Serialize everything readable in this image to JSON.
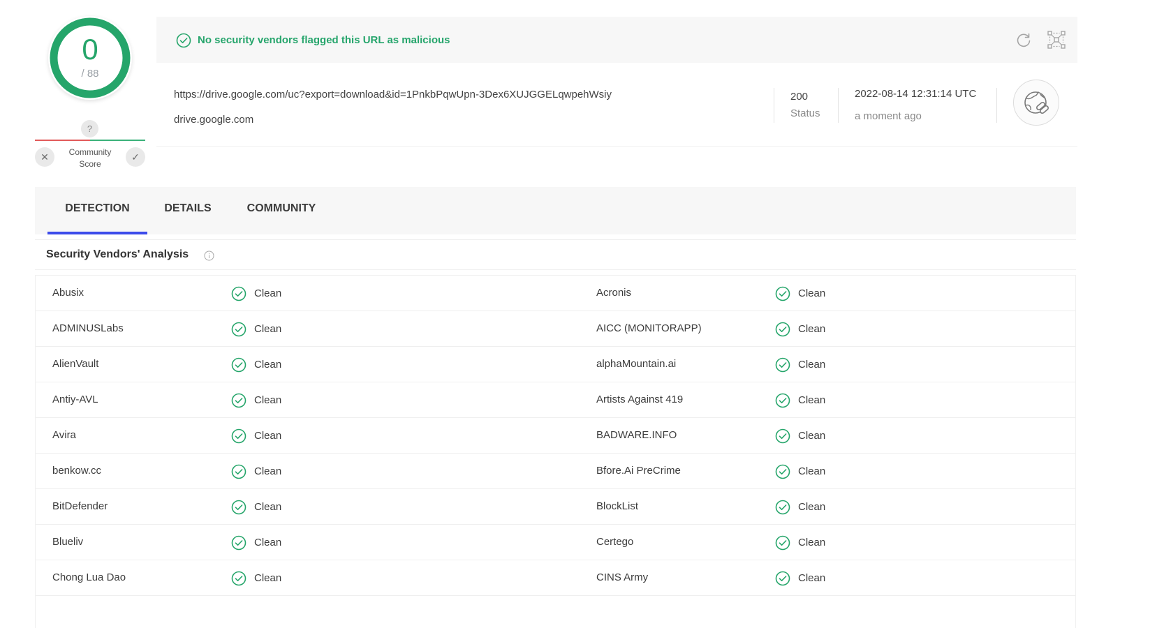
{
  "score": {
    "detections": "0",
    "total": "/ 88"
  },
  "community": {
    "question": "?",
    "label_line1": "Community",
    "label_line2": "Score",
    "down_glyph": "✕",
    "up_glyph": "✓"
  },
  "banner": {
    "message": "No security vendors flagged this URL as malicious"
  },
  "url_info": {
    "url": "https://drive.google.com/uc?export=download&id=1PnkbPqwUpn-3Dex6XUJGGELqwpehWsiy",
    "domain": "drive.google.com",
    "status_code": "200",
    "status_label": "Status",
    "scan_date": "2022-08-14 12:31:14 UTC",
    "scan_ago": "a moment ago"
  },
  "tabs": [
    {
      "label": "DETECTION",
      "active": true
    },
    {
      "label": "DETAILS",
      "active": false
    },
    {
      "label": "COMMUNITY",
      "active": false
    }
  ],
  "analysis": {
    "title": "Security Vendors' Analysis"
  },
  "vendors": [
    {
      "left_name": "Abusix",
      "left_result": "Clean",
      "right_name": "Acronis",
      "right_result": "Clean"
    },
    {
      "left_name": "ADMINUSLabs",
      "left_result": "Clean",
      "right_name": "AICC (MONITORAPP)",
      "right_result": "Clean"
    },
    {
      "left_name": "AlienVault",
      "left_result": "Clean",
      "right_name": "alphaMountain.ai",
      "right_result": "Clean"
    },
    {
      "left_name": "Antiy-AVL",
      "left_result": "Clean",
      "right_name": "Artists Against 419",
      "right_result": "Clean"
    },
    {
      "left_name": "Avira",
      "left_result": "Clean",
      "right_name": "BADWARE.INFO",
      "right_result": "Clean"
    },
    {
      "left_name": "benkow.cc",
      "left_result": "Clean",
      "right_name": "Bfore.Ai PreCrime",
      "right_result": "Clean"
    },
    {
      "left_name": "BitDefender",
      "left_result": "Clean",
      "right_name": "BlockList",
      "right_result": "Clean"
    },
    {
      "left_name": "Blueliv",
      "left_result": "Clean",
      "right_name": "Certego",
      "right_result": "Clean"
    },
    {
      "left_name": "Chong Lua Dao",
      "left_result": "Clean",
      "right_name": "CINS Army",
      "right_result": "Clean"
    }
  ],
  "colors": {
    "clean": "#25a56a",
    "tab_accent": "#3d4bea",
    "ring": "#25a56a"
  },
  "icons": {
    "banner": "check-circle-icon",
    "refresh": "refresh-icon",
    "graph": "graph-icon",
    "url_type": "web-link-icon",
    "info": "info-icon",
    "clean": "check-circle-icon"
  }
}
